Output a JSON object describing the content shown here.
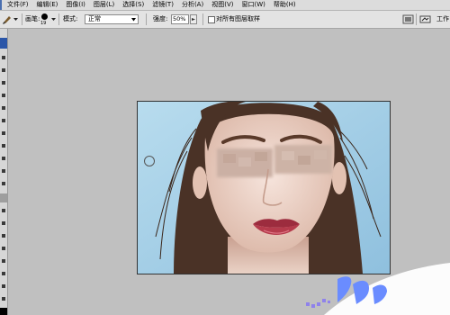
{
  "menubar": {
    "items": [
      {
        "label": "文件(F)"
      },
      {
        "label": "编辑(E)"
      },
      {
        "label": "图像(I)"
      },
      {
        "label": "图层(L)"
      },
      {
        "label": "选择(S)"
      },
      {
        "label": "滤镜(T)"
      },
      {
        "label": "分析(A)"
      },
      {
        "label": "视图(V)"
      },
      {
        "label": "窗口(W)"
      },
      {
        "label": "帮助(H)"
      }
    ]
  },
  "options": {
    "brush_label": "画笔:",
    "brush_size": "19",
    "mode_label": "模式:",
    "mode_value": "正常",
    "strength_label": "强度:",
    "strength_value": "50%",
    "sample_all_label": "对所有图层取样",
    "sample_all_checked": false,
    "workspace_label": "工作"
  },
  "document": {
    "content": "portrait photo of a woman with dark hair against a light blue background, eyes blurred out"
  },
  "colors": {
    "workspace": "#c0c0c0",
    "menubar": "#dcdcdc",
    "options_bar": "#e3e3e3",
    "photo_background": "#a8cfe6",
    "hair": "#4a3226",
    "skin": "#efd8cc",
    "lips": "#9c2c3e"
  },
  "icons": {
    "tool_preset": "ps-tool-preset-icon",
    "brush_preview": "brush-dot-icon",
    "dropdown": "chevron-down-icon",
    "palette_well": "palette-well-icon",
    "bridge": "bridge-icon"
  }
}
